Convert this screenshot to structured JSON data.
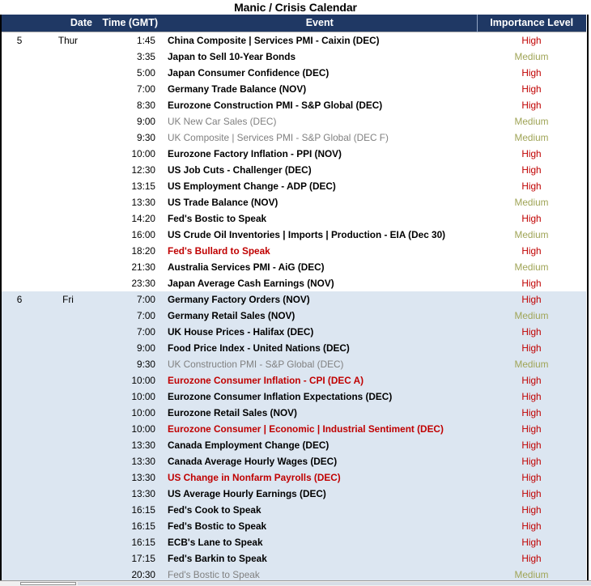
{
  "title": "Manic / Crisis Calendar",
  "columns": {
    "date": "Date",
    "time": "Time (GMT)",
    "event": "Event",
    "importance": "Importance Level"
  },
  "colors": {
    "header_bg": "#1f3864",
    "header_text": "#ffffff",
    "alt_row_bg": "#dce6f1",
    "high": "#c00000",
    "medium": "#9fa456",
    "alert_event": "#c00000",
    "muted_event": "#808080"
  },
  "scrollbar": {
    "orientation": "horizontal",
    "position": "bottom"
  },
  "rows": [
    {
      "day": "5",
      "dow": "Thur",
      "time": "1:45",
      "event": "China Composite | Services PMI - Caixin (DEC)",
      "importance": "High",
      "event_style": "normal",
      "band": "main"
    },
    {
      "day": "",
      "dow": "",
      "time": "3:35",
      "event": "Japan to Sell 10-Year Bonds",
      "importance": "Medium",
      "event_style": "normal",
      "band": "main"
    },
    {
      "day": "",
      "dow": "",
      "time": "5:00",
      "event": "Japan Consumer Confidence (DEC)",
      "importance": "High",
      "event_style": "normal",
      "band": "main"
    },
    {
      "day": "",
      "dow": "",
      "time": "7:00",
      "event": "Germany Trade Balance (NOV)",
      "importance": "High",
      "event_style": "normal",
      "band": "main"
    },
    {
      "day": "",
      "dow": "",
      "time": "8:30",
      "event": "Eurozone Construction PMI - S&P Global (DEC)",
      "importance": "High",
      "event_style": "normal",
      "band": "main"
    },
    {
      "day": "",
      "dow": "",
      "time": "9:00",
      "event": "UK New Car Sales (DEC)",
      "importance": "Medium",
      "event_style": "muted",
      "band": "main"
    },
    {
      "day": "",
      "dow": "",
      "time": "9:30",
      "event": "UK Composite | Services PMI - S&P Global (DEC F)",
      "importance": "Medium",
      "event_style": "muted",
      "band": "main"
    },
    {
      "day": "",
      "dow": "",
      "time": "10:00",
      "event": "Eurozone Factory Inflation - PPI (NOV)",
      "importance": "High",
      "event_style": "normal",
      "band": "main"
    },
    {
      "day": "",
      "dow": "",
      "time": "12:30",
      "event": "US Job Cuts - Challenger (DEC)",
      "importance": "High",
      "event_style": "normal",
      "band": "main"
    },
    {
      "day": "",
      "dow": "",
      "time": "13:15",
      "event": "US Employment Change - ADP (DEC)",
      "importance": "High",
      "event_style": "normal",
      "band": "main"
    },
    {
      "day": "",
      "dow": "",
      "time": "13:30",
      "event": "US Trade Balance (NOV)",
      "importance": "Medium",
      "event_style": "normal",
      "band": "main"
    },
    {
      "day": "",
      "dow": "",
      "time": "14:20",
      "event": "Fed's Bostic to Speak",
      "importance": "High",
      "event_style": "normal",
      "band": "main"
    },
    {
      "day": "",
      "dow": "",
      "time": "16:00",
      "event": "US Crude Oil Inventories | Imports | Production - EIA (Dec 30)",
      "importance": "Medium",
      "event_style": "normal",
      "band": "main"
    },
    {
      "day": "",
      "dow": "",
      "time": "18:20",
      "event": "Fed's Bullard to Speak",
      "importance": "High",
      "event_style": "alert",
      "band": "main"
    },
    {
      "day": "",
      "dow": "",
      "time": "21:30",
      "event": "Australia Services PMI - AiG (DEC)",
      "importance": "Medium",
      "event_style": "normal",
      "band": "main"
    },
    {
      "day": "",
      "dow": "",
      "time": "23:30",
      "event": "Japan Average Cash Earnings (NOV)",
      "importance": "High",
      "event_style": "normal",
      "band": "main"
    },
    {
      "day": "6",
      "dow": "Fri",
      "time": "7:00",
      "event": "Germany Factory Orders (NOV)",
      "importance": "High",
      "event_style": "normal",
      "band": "alt"
    },
    {
      "day": "",
      "dow": "",
      "time": "7:00",
      "event": "Germany Retail Sales (NOV)",
      "importance": "Medium",
      "event_style": "normal",
      "band": "alt"
    },
    {
      "day": "",
      "dow": "",
      "time": "7:00",
      "event": "UK House Prices - Halifax (DEC)",
      "importance": "High",
      "event_style": "normal",
      "band": "alt"
    },
    {
      "day": "",
      "dow": "",
      "time": "9:00",
      "event": "Food Price Index - United Nations (DEC)",
      "importance": "High",
      "event_style": "normal",
      "band": "alt"
    },
    {
      "day": "",
      "dow": "",
      "time": "9:30",
      "event": "UK Construction PMI - S&P Global (DEC)",
      "importance": "Medium",
      "event_style": "muted",
      "band": "alt"
    },
    {
      "day": "",
      "dow": "",
      "time": "10:00",
      "event": "Eurozone Consumer Inflation - CPI (DEC A)",
      "importance": "High",
      "event_style": "alert",
      "band": "alt"
    },
    {
      "day": "",
      "dow": "",
      "time": "10:00",
      "event": "Eurozone Consumer Inflation Expectations (DEC)",
      "importance": "High",
      "event_style": "normal",
      "band": "alt"
    },
    {
      "day": "",
      "dow": "",
      "time": "10:00",
      "event": "Eurozone Retail Sales (NOV)",
      "importance": "High",
      "event_style": "normal",
      "band": "alt"
    },
    {
      "day": "",
      "dow": "",
      "time": "10:00",
      "event": "Eurozone Consumer | Economic | Industrial Sentiment (DEC)",
      "importance": "High",
      "event_style": "alert",
      "band": "alt"
    },
    {
      "day": "",
      "dow": "",
      "time": "13:30",
      "event": "Canada Employment Change (DEC)",
      "importance": "High",
      "event_style": "normal",
      "band": "alt"
    },
    {
      "day": "",
      "dow": "",
      "time": "13:30",
      "event": "Canada Average Hourly Wages (DEC)",
      "importance": "High",
      "event_style": "normal",
      "band": "alt"
    },
    {
      "day": "",
      "dow": "",
      "time": "13:30",
      "event": "US Change in Nonfarm Payrolls (DEC)",
      "importance": "High",
      "event_style": "alert",
      "band": "alt"
    },
    {
      "day": "",
      "dow": "",
      "time": "13:30",
      "event": "US Average Hourly Earnings (DEC)",
      "importance": "High",
      "event_style": "normal",
      "band": "alt"
    },
    {
      "day": "",
      "dow": "",
      "time": "16:15",
      "event": "Fed's Cook to Speak",
      "importance": "High",
      "event_style": "normal",
      "band": "alt"
    },
    {
      "day": "",
      "dow": "",
      "time": "16:15",
      "event": "Fed's Bostic to Speak",
      "importance": "High",
      "event_style": "normal",
      "band": "alt"
    },
    {
      "day": "",
      "dow": "",
      "time": "16:15",
      "event": "ECB's Lane to Speak",
      "importance": "High",
      "event_style": "normal",
      "band": "alt"
    },
    {
      "day": "",
      "dow": "",
      "time": "17:15",
      "event": "Fed's Barkin to Speak",
      "importance": "High",
      "event_style": "normal",
      "band": "alt"
    },
    {
      "day": "",
      "dow": "",
      "time": "20:30",
      "event": "Fed's Bostic to Speak",
      "importance": "Medium",
      "event_style": "muted",
      "band": "alt"
    }
  ]
}
